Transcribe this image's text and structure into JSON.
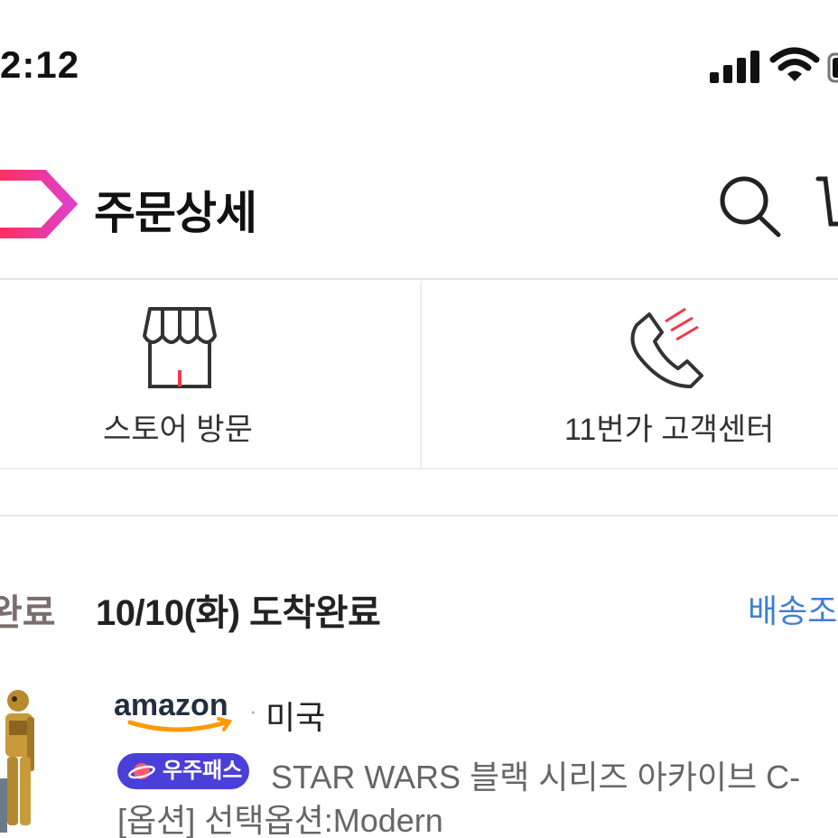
{
  "status_bar": {
    "time": "2:12"
  },
  "header": {
    "title": "주문상세"
  },
  "actions": {
    "store_label": "스토어 방문",
    "customer_center_label": "11번가 고객센터"
  },
  "order": {
    "prev_status": "완료",
    "status": "10/10(화) 도착완료",
    "tracking_link": "배송조회"
  },
  "product": {
    "seller_logo": "amazon",
    "seller_dot": "·",
    "seller_country": "미국",
    "badge": "우주패스",
    "name": "STAR WARS 블랙 시리즈 아카이브 C-",
    "option": "[옵션] 선택옵션:Modern"
  },
  "colors": {
    "brand_gradient_start": "#ff2d55",
    "brand_gradient_end": "#e040c8",
    "link_blue": "#3d7fd6",
    "badge_purple": "#4a3fd8"
  },
  "icons": [
    "signal-icon",
    "wifi-icon",
    "battery-icon",
    "back-logo-icon",
    "search-icon",
    "cart-icon",
    "store-icon",
    "phone-icon",
    "planet-icon"
  ]
}
